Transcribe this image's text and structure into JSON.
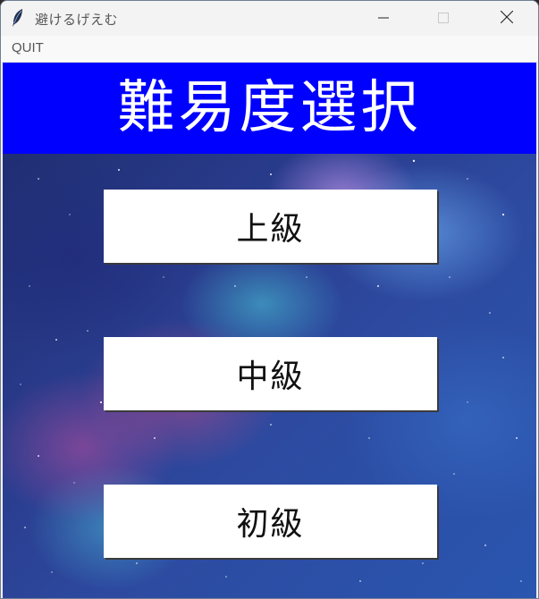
{
  "window": {
    "title": "避けるげえむ",
    "app_icon": "feather-icon",
    "controls": [
      "minimize-icon",
      "maximize-icon",
      "close-icon"
    ]
  },
  "menubar": {
    "items": [
      {
        "label": "QUIT"
      }
    ]
  },
  "screen": {
    "title": "難易度選択",
    "title_bg": "#0000ff",
    "title_color": "#ffffff",
    "background": "starry-galaxy",
    "buttons": [
      {
        "label": "上級"
      },
      {
        "label": "中級"
      },
      {
        "label": "初級"
      }
    ]
  }
}
